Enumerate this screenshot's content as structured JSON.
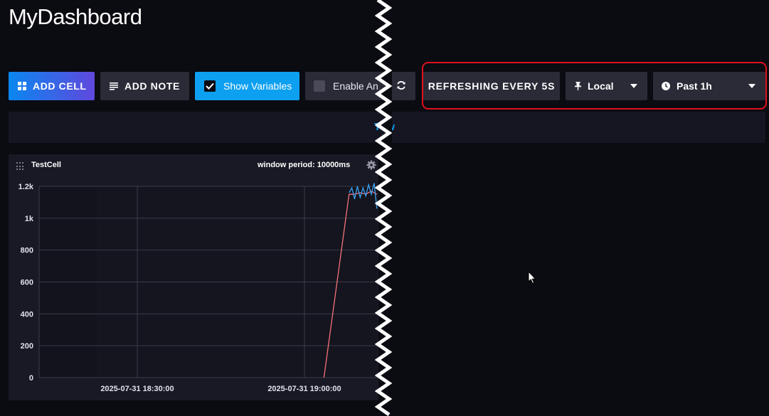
{
  "app": {
    "title": "MyDashboard"
  },
  "toolbar": {
    "add_cell": "ADD CELL",
    "add_note": "ADD NOTE",
    "show_variables": "Show Variables",
    "enable_annotations": "Enable An",
    "refreshing": "REFRESHING EVERY 5S",
    "timezone": "Local",
    "time_range": "Past 1h"
  },
  "variables_bar": {
    "text": "Tow"
  },
  "cell": {
    "title": "TestCell",
    "window_period": "window period: 10000ms"
  },
  "chart_data": {
    "type": "line",
    "title": "TestCell",
    "xlabel": "",
    "ylabel": "",
    "ylim": [
      0,
      1200
    ],
    "yticks": [
      "0",
      "200",
      "400",
      "600",
      "800",
      "1k",
      "1.2k"
    ],
    "xticks": [
      "2025-07-31 18:30:00",
      "2025-07-31 19:00:00"
    ],
    "grid": true,
    "series": [
      {
        "color": "#f4727c",
        "x": [
          "2025-07-31 19:03:30",
          "2025-07-31 19:08:00",
          "2025-07-31 19:09:00",
          "2025-07-31 19:10:00",
          "2025-07-31 19:11:00",
          "2025-07-31 19:12:00",
          "2025-07-31 19:13:00"
        ],
        "values": [
          0,
          1150,
          1150,
          1160,
          1150,
          1170,
          1150
        ]
      },
      {
        "color": "#3aa3f5",
        "x": [
          "2025-07-31 19:08:00",
          "2025-07-31 19:08:30",
          "2025-07-31 19:09:00",
          "2025-07-31 19:09:30",
          "2025-07-31 19:10:00",
          "2025-07-31 19:10:30",
          "2025-07-31 19:11:00",
          "2025-07-31 19:11:30",
          "2025-07-31 19:12:00",
          "2025-07-31 19:12:30",
          "2025-07-31 19:13:00"
        ],
        "values": [
          1160,
          1190,
          1120,
          1200,
          1130,
          1190,
          1140,
          1210,
          1150,
          1220,
          1060
        ]
      }
    ]
  },
  "colors": {
    "accent": "#0d9ff0",
    "highlight": "#e0101c",
    "background": "#0b0b12",
    "button": "#2a2b37"
  },
  "icons": {
    "add_cell": "grid-icon",
    "add_note": "note-lines-icon",
    "refresh": "refresh-icon",
    "timezone": "pin-icon",
    "time_range": "clock-icon",
    "cell_settings": "gear-icon"
  }
}
